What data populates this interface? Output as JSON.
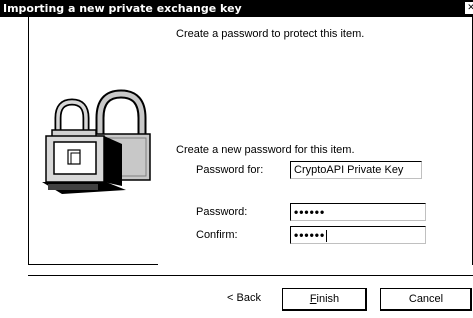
{
  "window": {
    "title": "Importing a new private exchange key",
    "close_glyph": "✕"
  },
  "content": {
    "intro": "Create a password to protect this item.",
    "section_label": "Create a new password for this item.",
    "password_for_label": "Password for:",
    "password_for_value": "CryptoAPI Private Key",
    "password_label": "Password:",
    "password_value": "••••••",
    "confirm_label": "Confirm:",
    "confirm_value": "••••••"
  },
  "buttons": {
    "back": "< Back",
    "finish_mnemonic": "F",
    "finish_rest": "inish",
    "cancel": "Cancel"
  },
  "icons": {
    "illustration": "padlock-computer-icon"
  }
}
